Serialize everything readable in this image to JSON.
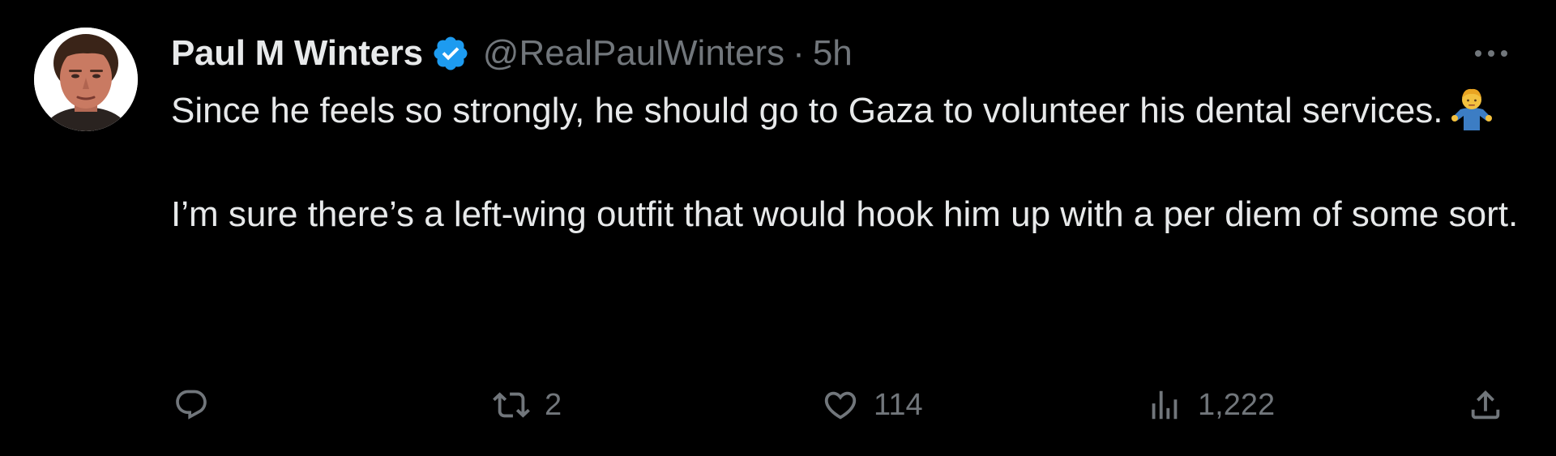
{
  "tweet": {
    "author": {
      "display_name": "Paul M Winters",
      "handle": "@RealPaulWinters",
      "verified": true,
      "avatar_icon": "profile-photo"
    },
    "separator": "·",
    "time": "5h",
    "body": {
      "paragraph1": "Since he feels so strongly, he should go to Gaza to volunteer his dental services.",
      "paragraph1_emoji": "🤷‍♂️ (shrugging man emoji)",
      "paragraph2": "I’m sure there’s a left-wing outfit that would hook him up with a per diem of some sort."
    },
    "actions": {
      "reply": {
        "icon": "reply-icon",
        "count": ""
      },
      "retweet": {
        "icon": "retweet-icon",
        "count": "2"
      },
      "like": {
        "icon": "heart-icon",
        "count": "114"
      },
      "views": {
        "icon": "views-icon",
        "count": "1,222"
      },
      "share": {
        "icon": "share-icon"
      }
    }
  },
  "colors": {
    "background": "#000000",
    "primary_text": "#e7e9ea",
    "secondary_text": "#71767b",
    "verified_badge": "#1d9bf0"
  }
}
